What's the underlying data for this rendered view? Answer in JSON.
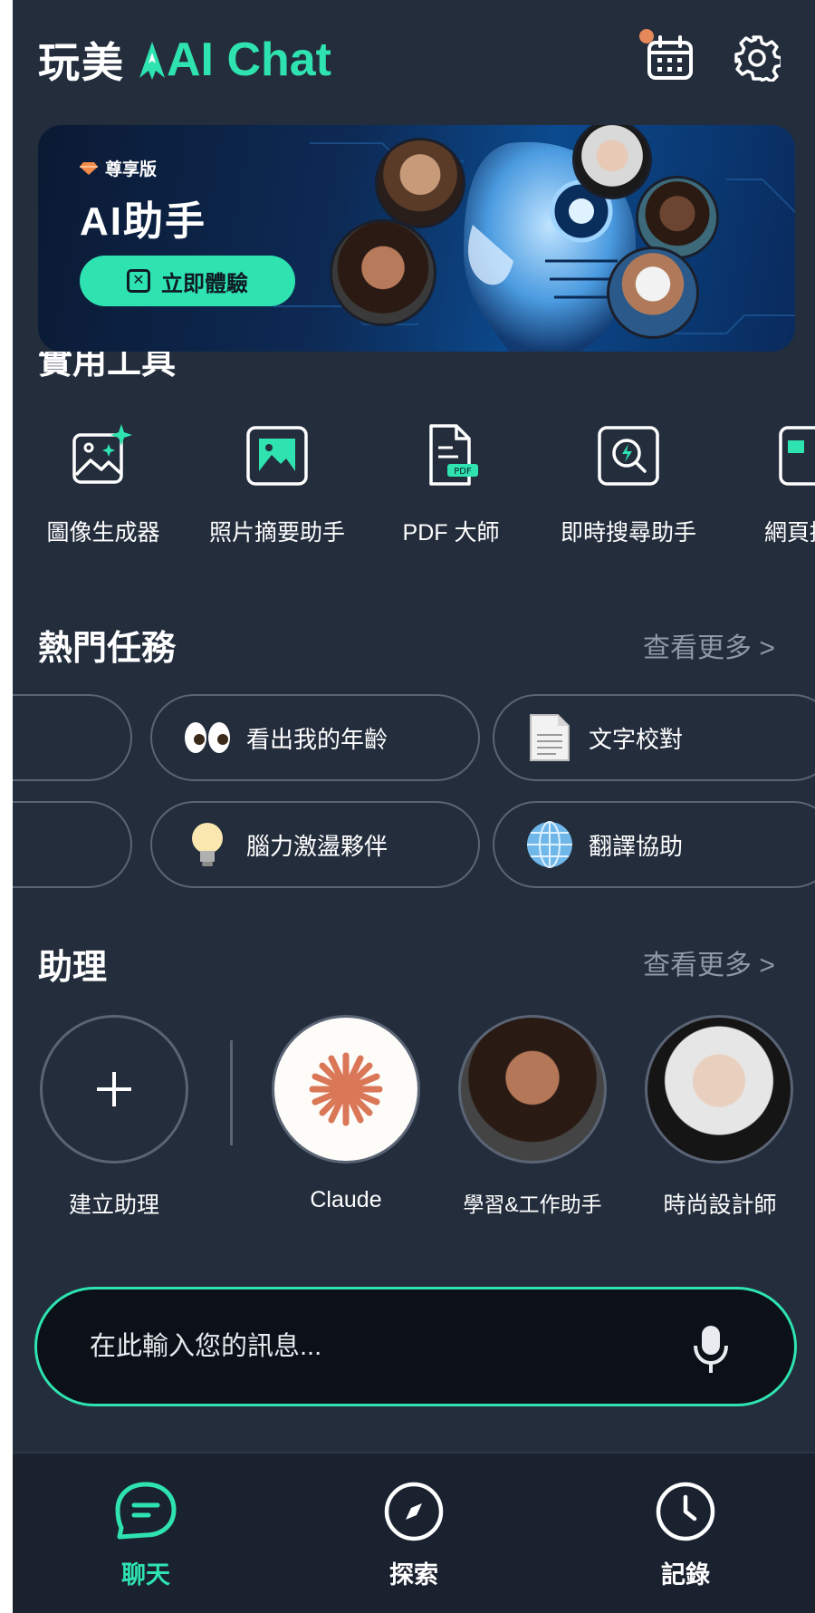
{
  "app": {
    "logo_cn": "玩美",
    "logo_ai": "AI Chat",
    "accent": "#2ee3b0",
    "background": "#232d3c"
  },
  "header": {
    "calendar_icon": "calendar-icon",
    "settings_icon": "gear-icon",
    "has_notification": true
  },
  "banner": {
    "tier": "尊享版",
    "title": "AI助手",
    "cta": "立即體驗"
  },
  "tools": {
    "title": "實用工具",
    "items": [
      {
        "label": "圖像生成器",
        "icon": "image-sparkle-icon"
      },
      {
        "label": "照片摘要助手",
        "icon": "photo-icon"
      },
      {
        "label": "PDF 大師",
        "icon": "pdf-file-icon",
        "icon_text": "PDF"
      },
      {
        "label": "即時搜尋助手",
        "icon": "search-lightning-icon"
      },
      {
        "label": "網頁摘要",
        "icon": "webpage-icon"
      }
    ]
  },
  "tasks": {
    "title": "熱門任務",
    "more": "查看更多 >",
    "rows": [
      [
        {
          "label": "看出我的年齡",
          "icon": "eyes-emoji"
        },
        {
          "label": "文字校對",
          "icon": "document-emoji"
        }
      ],
      [
        {
          "label": "腦力激盪夥伴",
          "icon": "light-bulb-emoji"
        },
        {
          "label": "翻譯協助",
          "icon": "globe-emoji"
        }
      ]
    ]
  },
  "assistants": {
    "title": "助理",
    "more": "查看更多 >",
    "create": "建立助理",
    "items": [
      {
        "label": "Claude",
        "icon": "claude-logo"
      },
      {
        "label": "學習&工作助手",
        "icon": "avatar-portrait"
      },
      {
        "label": "時尚設計師",
        "icon": "avatar-portrait"
      }
    ]
  },
  "input": {
    "placeholder": "在此輸入您的訊息..."
  },
  "nav": {
    "items": [
      {
        "label": "聊天",
        "icon": "chat-icon",
        "active": true
      },
      {
        "label": "探索",
        "icon": "compass-icon",
        "active": false
      },
      {
        "label": "記錄",
        "icon": "clock-icon",
        "active": false
      }
    ]
  }
}
